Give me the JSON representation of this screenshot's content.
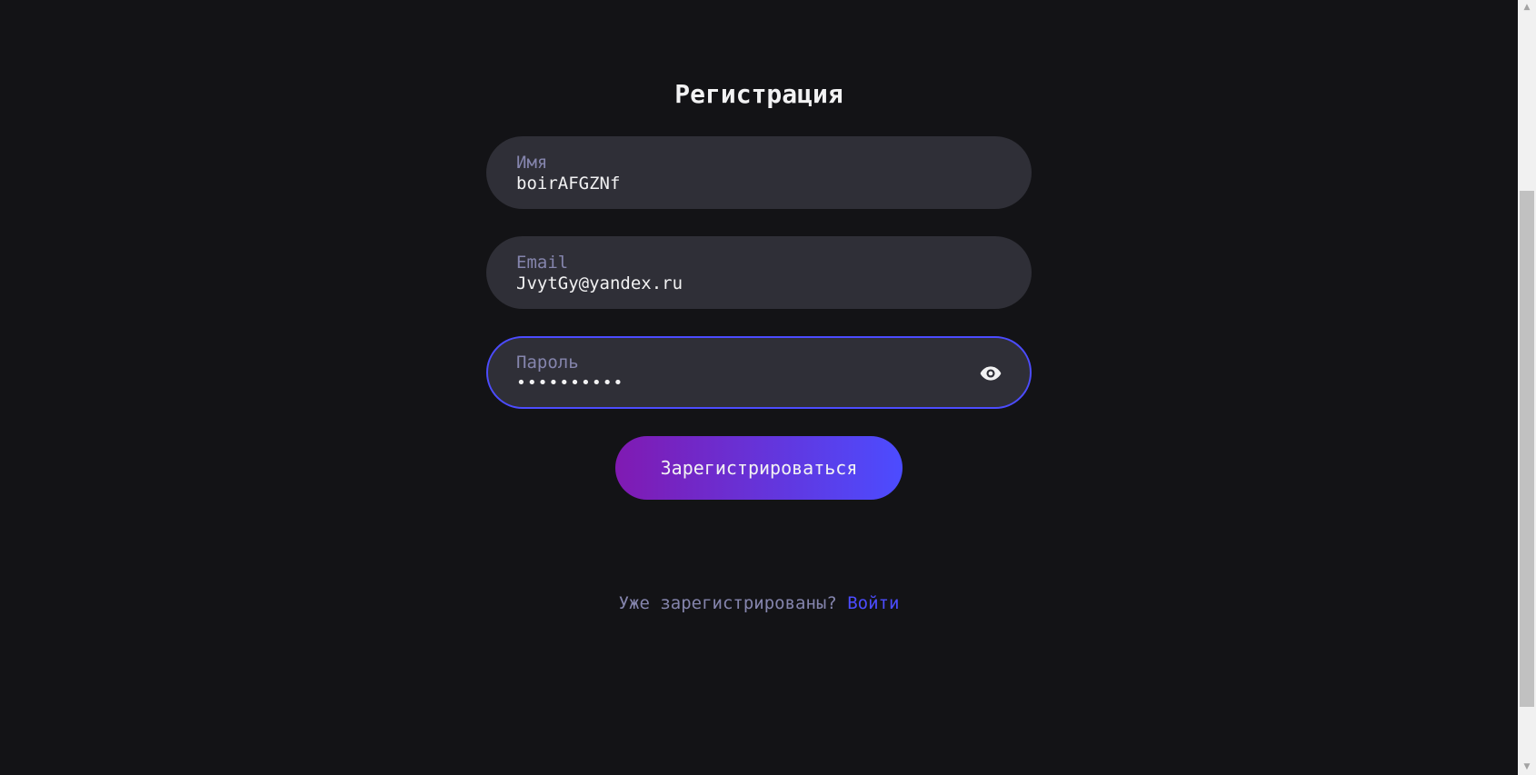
{
  "page": {
    "title": "Регистрация"
  },
  "form": {
    "name_field": {
      "label": "Имя",
      "value": "boirAFGZNf"
    },
    "email_field": {
      "label": "Email",
      "value": "JvytGy@yandex.ru"
    },
    "password_field": {
      "label": "Пароль",
      "value": "••••••••••",
      "toggle_icon": "eye-icon"
    },
    "submit_label": "Зарегистрироваться"
  },
  "footer": {
    "prompt": "Уже зарегистрированы?",
    "link_label": "Войти"
  },
  "colors": {
    "background": "#131316",
    "field_bg": "#2f2f37",
    "accent": "#4c4cff",
    "gradient_start": "#801ab2",
    "muted_text": "#8585ad",
    "text": "#f2f2f3"
  },
  "scrollbar": {
    "up_icon": "scroll-up-arrow-icon",
    "down_icon": "scroll-down-arrow-icon"
  }
}
